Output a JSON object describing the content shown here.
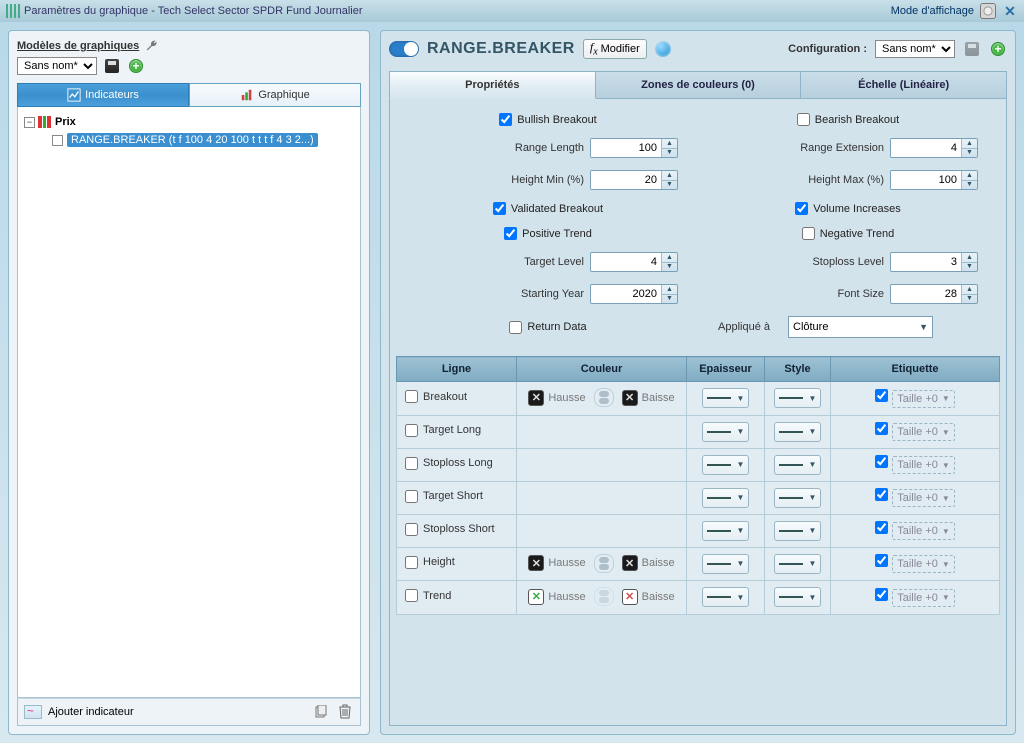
{
  "title": "Paramètres du graphique - Tech Select Sector SPDR Fund Journalier",
  "display_mode": "Mode d'affichage",
  "models": {
    "title": "Modèles de graphiques",
    "select_value": "Sans nom*"
  },
  "left_tabs": {
    "indicators": "Indicateurs",
    "chart": "Graphique"
  },
  "tree": {
    "root": "Prix",
    "child": "RANGE.BREAKER (t f 100 4 20 100 t t t f 4 3 2...)"
  },
  "add_indicator": "Ajouter indicateur",
  "indicator_name": "RANGE.BREAKER",
  "modify_btn": "Modifier",
  "config_label": "Configuration :",
  "config_value": "Sans nom*",
  "right_tabs": {
    "props": "Propriétés",
    "zones": "Zones de couleurs (0)",
    "scale": "Échelle (Linéaire)"
  },
  "fields": {
    "bullish": "Bullish Breakout",
    "bearish": "Bearish Breakout",
    "range_length_lbl": "Range Length",
    "range_length": "100",
    "range_ext_lbl": "Range Extension",
    "range_ext": "4",
    "hmin_lbl": "Height Min (%)",
    "hmin": "20",
    "hmax_lbl": "Height Max (%)",
    "hmax": "100",
    "validated": "Validated Breakout",
    "volinc": "Volume Increases",
    "postrend": "Positive Trend",
    "negtrend": "Negative Trend",
    "target_lbl": "Target Level",
    "target": "4",
    "stop_lbl": "Stoploss Level",
    "stop": "3",
    "year_lbl": "Starting Year",
    "year": "2020",
    "font_lbl": "Font Size",
    "font": "28",
    "return_data": "Return Data",
    "applied_lbl": "Appliqué à",
    "applied_val": "Clôture"
  },
  "table": {
    "headers": {
      "line": "Ligne",
      "color": "Couleur",
      "thick": "Epaisseur",
      "style": "Style",
      "label": "Etiquette"
    },
    "hausse": "Hausse",
    "baisse": "Baisse",
    "taille": "Taille +0",
    "rows": [
      "Breakout",
      "Target Long",
      "Stoploss Long",
      "Target Short",
      "Stoploss Short",
      "Height",
      "Trend"
    ]
  }
}
